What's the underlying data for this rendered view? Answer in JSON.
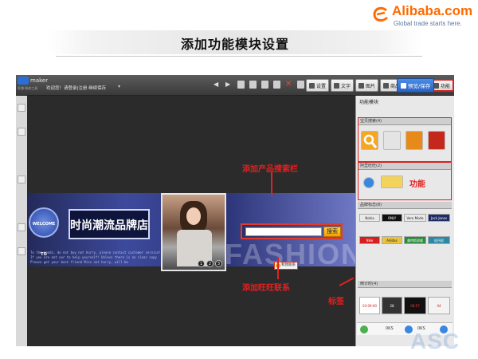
{
  "header": {
    "brand": "Alibaba.com",
    "tagline": "Global trade starts here.",
    "slide_title": "添加功能模块设置"
  },
  "app": {
    "logo_text": "maker",
    "sub_line": "旺铺·装修工具",
    "welcome": "欢迎您！请登录|注册 继续保存",
    "toolbar": {
      "settings": "设置",
      "text": "文字",
      "image": "图片",
      "goods": "商品",
      "card": "动画",
      "module": "功能",
      "preview": "预览/保存"
    }
  },
  "canvas": {
    "welcome_badge": "WELCOME TO",
    "shop_name": "时尚潮流品牌店",
    "scribble": "To the goods, do not buy not hurry, please contact customer service! If you are not our to help yourself! Unless there is no clear copy Please get your best friend Miss not hurry, will be",
    "search_button": "搜索",
    "wangwang_label": "和我联系",
    "watermark": "FASHION",
    "photo_dots": [
      "1",
      "2",
      "3"
    ]
  },
  "annotations": {
    "search_bar": "添加产品搜索栏",
    "wangwang": "添加旺旺联系",
    "function": "功能",
    "tab": "标签"
  },
  "right_panel": {
    "title": "功能模块",
    "tabs": [
      "宝贝搜索(4)",
      "阿里旺旺(2)",
      "品牌标志(8)",
      "倒计时(4)"
    ],
    "brand_thumbs": [
      "Nokia",
      "ONLY",
      "Vero Moda",
      "Jack Jones",
      "Nike",
      "Adidas",
      "美特斯邦威",
      "佐丹奴"
    ],
    "countdown_thumbs": [
      "03:09:00",
      "28",
      "08:57",
      "04"
    ],
    "status": [
      "0KS",
      "0KS"
    ]
  }
}
